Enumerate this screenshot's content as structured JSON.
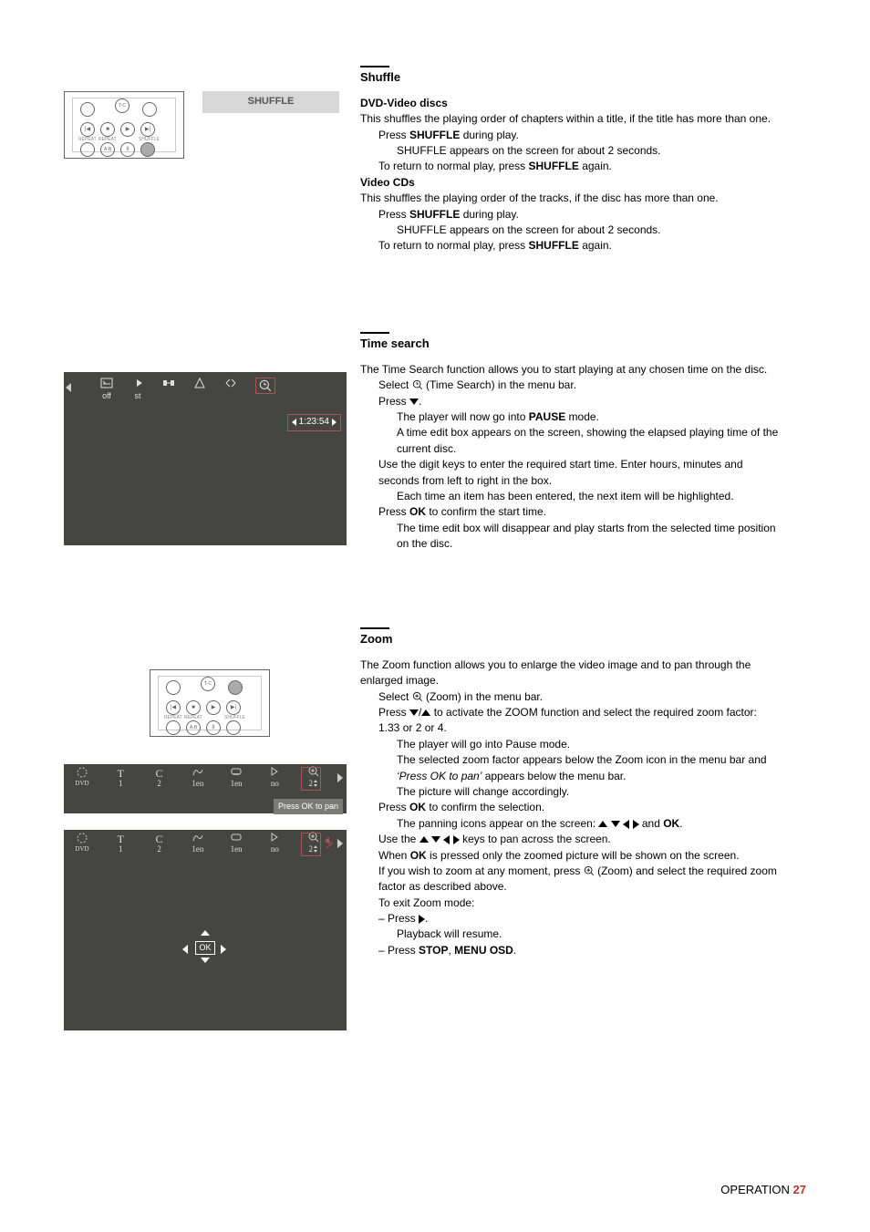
{
  "sections": {
    "shuffle": {
      "title": "Shuffle",
      "button_label": "SHUFFLE",
      "dvd_heading": "DVD-Video discs",
      "dvd_intro": "This shuffles the playing order of chapters within a title, if the title has more than one.",
      "dvd_step1_pre": "Press ",
      "dvd_step1_bold": "SHUFFLE",
      "dvd_step1_post": " during play.",
      "dvd_result": "SHUFFLE appears on the screen for about 2 seconds.",
      "dvd_return_pre": "To return to normal play, press ",
      "dvd_return_bold": "SHUFFLE",
      "dvd_return_post": " again.",
      "vcd_heading": "Video CDs",
      "vcd_intro": "This shuffles the playing order of the tracks, if the disc has more than one.",
      "vcd_step1_pre": "Press ",
      "vcd_step1_bold": "SHUFFLE",
      "vcd_step1_post": " during play.",
      "vcd_result": "SHUFFLE appears on the screen for about 2 seconds.",
      "vcd_return_pre": "To return to normal play, press ",
      "vcd_return_bold": "SHUFFLE",
      "vcd_return_post": " again."
    },
    "timesearch": {
      "title": "Time search",
      "intro": "The Time Search function allows you to start playing at any chosen time on the disc.",
      "step_select": "Select ",
      "step_select_post": " (Time Search) in the menu bar.",
      "step_press_down": "Press ",
      "pause_line_pre": "The player will now go into ",
      "pause_line_bold": "PAUSE",
      "pause_line_post": " mode.",
      "timebox_line": "A time edit box appears on the screen, showing the elapsed playing time of the current disc.",
      "digits_line": "Use the digit keys to enter the required start time. Enter hours, minutes and seconds from left to right in the box.",
      "highlight_line": "Each time an item has been entered, the next item will be highlighted.",
      "ok_line_pre": "Press ",
      "ok_line_bold": "OK",
      "ok_line_post": " to confirm the start time.",
      "final_line": "The time edit box will disappear and play starts from the selected time position on the disc.",
      "panel": {
        "off": "off",
        "st": "st",
        "time": "1:23:54"
      }
    },
    "zoom": {
      "title": "Zoom",
      "intro": "The Zoom function allows you to enlarge the video image and to pan through the enlarged image.",
      "step_select": "Select ",
      "step_select_post": " (Zoom) in the menu bar.",
      "step_press_pre": "Press ",
      "step_press_post": " to activate the ZOOM function and select the required zoom factor: 1.33 or 2 or 4.",
      "pause_line": "The player will go into Pause mode.",
      "factor_line_pre": "The selected zoom factor appears below the Zoom icon in the menu bar and ",
      "factor_line_italic": "‘Press OK to pan’",
      "factor_line_post": " appears below the menu bar.",
      "change_line": "The picture will change accordingly.",
      "ok_line_pre": "Press ",
      "ok_line_bold": "OK",
      "ok_line_post": " to confirm the selection.",
      "pan_icons_pre": "The panning icons appear on the screen: ",
      "pan_icons_post": " and ",
      "pan_icons_ok": "OK",
      "use_keys_pre": "Use the ",
      "use_keys_post": " keys to pan across the screen.",
      "when_ok_pre": "When ",
      "when_ok_bold": "OK",
      "when_ok_post": " is pressed only the zoomed picture will be shown on the screen.",
      "anytime_pre": "If you wish to zoom at any moment, press ",
      "anytime_post": " (Zoom) and select the required zoom factor as described above.",
      "exit_line": "To exit Zoom mode:",
      "exit_press": "– Press ",
      "resume_line": "Playback will resume.",
      "exit_stop_pre": "– Press ",
      "exit_stop_bold1": "STOP",
      "exit_stop_sep": ", ",
      "exit_stop_bold2": "MENU OSD",
      "exit_stop_post": ".",
      "bar": {
        "dvd": "DVD",
        "c1": "1",
        "c2": "2",
        "c3": "1en",
        "c4": "1en",
        "c5": "no",
        "c6": "2",
        "press_ok": "Press OK to pan",
        "ok": "OK"
      }
    }
  },
  "remote_labels": {
    "repeat1": "REPEAT",
    "repeat2": "REPEAT",
    "shuffle": "SHUFFLE"
  },
  "footer": {
    "label": "OPERATION",
    "page": "27"
  }
}
